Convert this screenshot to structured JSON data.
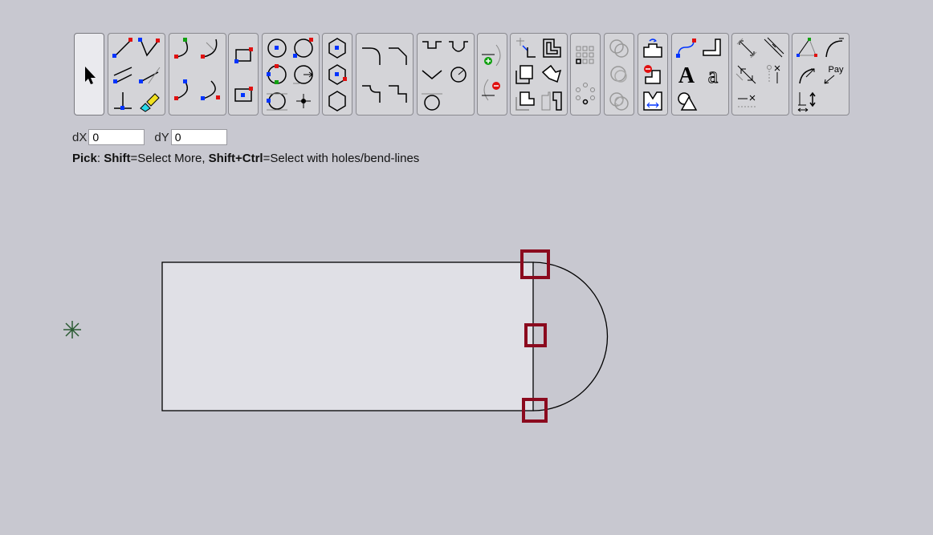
{
  "coords": {
    "dx_label": "dX",
    "dx_value": "0",
    "dy_label": "dY",
    "dy_value": "0"
  },
  "hint": {
    "mode": "Pick",
    "sep1": ": ",
    "key1": "Shift",
    "desc1": "=Select More, ",
    "key2": "Shift+Ctrl",
    "desc2": "=Select with holes/bend-lines"
  },
  "toolbar_icons": {
    "g1": [
      "pick-arrow-icon"
    ],
    "g2": [
      "line-icon",
      "polyline-icon",
      "parallel-lines-icon",
      "tangent-line-icon",
      "perpendicular-icon",
      "edit-pencil-icon"
    ],
    "g3": [
      "arc-3point-icon",
      "arc-tangent-icon",
      "arc-center-icon",
      "arc-end-icon"
    ],
    "g4": [
      "rectangle-icon",
      "rectangle-center-icon"
    ],
    "g5": [
      "circle-center-icon",
      "circle-2point-icon",
      "circle-3point-icon",
      "circle-radius-icon",
      "circle-tangent-icon",
      "point-icon"
    ],
    "g6": [
      "hexagon-center-icon",
      "hexagon-side-icon",
      "hexagon-icon"
    ],
    "g7": [
      "fillet-icon",
      "chamfer-icon",
      "corner-notch-icon",
      "step-corner-icon"
    ],
    "g8": [
      "slot-square-icon",
      "slot-round-icon",
      "v-notch-icon",
      "radius-notch-icon",
      "circle-cutout-icon"
    ],
    "g9": [
      "break-add-icon",
      "break-remove-icon"
    ],
    "g10": [
      "trim-icon",
      "offset-shape-icon",
      "union-icon",
      "rotate-shape-icon",
      "subtract-icon",
      "mirror-icon"
    ],
    "g11": [
      "grid-pattern-icon",
      "circular-pattern-icon"
    ],
    "g12": [
      "ring-icon",
      "ring-outline-icon",
      "ring-double-icon"
    ],
    "g13": [
      "flange-icon",
      "remove-flange-icon",
      "stretch-icon"
    ],
    "g14": [
      "spline-icon",
      "bend-icon",
      "text-icon",
      "engraving-icon",
      "shapes-icon"
    ],
    "g15": [
      "dimension-aligned-icon",
      "dimension-parallel-icon",
      "dimension-angle-icon",
      "dimension-offset-icon",
      "dimension-delete-icon"
    ],
    "g16": [
      "measure-triangle-icon",
      "radius-arc-icon",
      "measure-radius-icon",
      "pay-icon",
      "dimension-vertical-icon"
    ]
  },
  "pay_label": "Pay",
  "colors": {
    "background": "#c8c8d0",
    "shape_fill": "#e0e0e6",
    "handle": "#8b0a1e",
    "origin": "#2a5a32",
    "blue": "#0033ff",
    "red": "#e01010",
    "green": "#10a010"
  }
}
